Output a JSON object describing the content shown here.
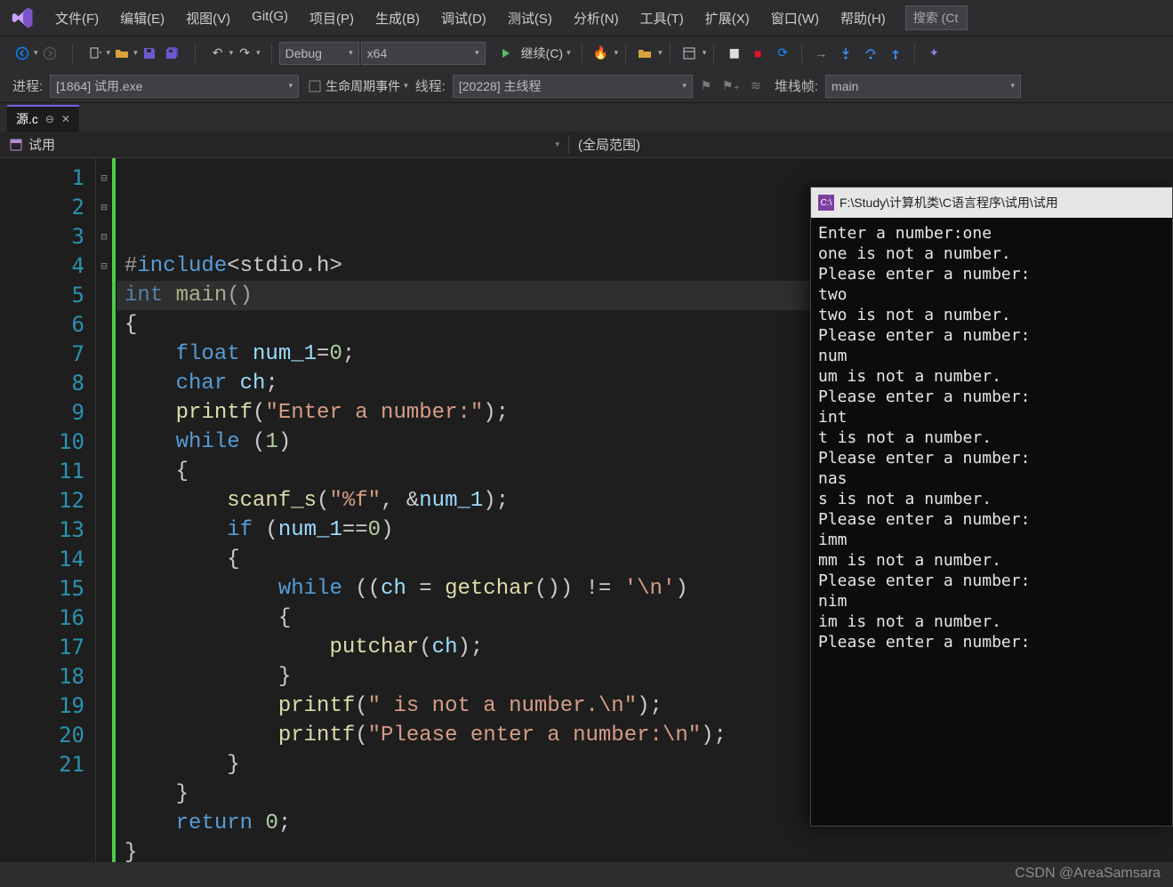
{
  "menu": {
    "items": [
      "文件(F)",
      "编辑(E)",
      "视图(V)",
      "Git(G)",
      "项目(P)",
      "生成(B)",
      "调试(D)",
      "测试(S)",
      "分析(N)",
      "工具(T)",
      "扩展(X)",
      "窗口(W)",
      "帮助(H)"
    ],
    "search_placeholder": "搜索 (Ct"
  },
  "toolbar1": {
    "config": "Debug",
    "platform": "x64",
    "resume": "继续(C)"
  },
  "toolbar2": {
    "process_label": "进程:",
    "process_value": "[1864] 试用.exe",
    "lifecycle": "生命周期事件",
    "thread_label": "线程:",
    "thread_value": "[20228] 主线程",
    "stack_label": "堆栈帧:",
    "stack_value": "main"
  },
  "tab": {
    "name": "源.c"
  },
  "crumb": {
    "proj": "试用",
    "scope": "(全局范围)"
  },
  "code": {
    "lines": 21,
    "raw": "#include<stdio.h>\nint main()\n{\n    float num_1=0;\n    char ch;\n    printf(\"Enter a number:\");\n    while (1)\n    {\n        scanf_s(\"%f\", &num_1);\n        if (num_1==0)\n        {\n            while ((ch = getchar()) != '\\n')\n            {\n                putchar(ch);\n            }\n            printf(\" is not a number.\\n\");\n            printf(\"Please enter a number:\\n\");\n        }\n    }\n    return 0;\n}"
  },
  "terminal": {
    "title": "F:\\Study\\计算机类\\C语言程序\\试用\\试用",
    "output": "Enter a number:one\none is not a number.\nPlease enter a number:\ntwo\ntwo is not a number.\nPlease enter a number:\nnum\num is not a number.\nPlease enter a number:\nint\nt is not a number.\nPlease enter a number:\nnas\ns is not a number.\nPlease enter a number:\nimm\nmm is not a number.\nPlease enter a number:\nnim\nim is not a number.\nPlease enter a number:"
  },
  "watermark": "CSDN @AreaSamsara"
}
